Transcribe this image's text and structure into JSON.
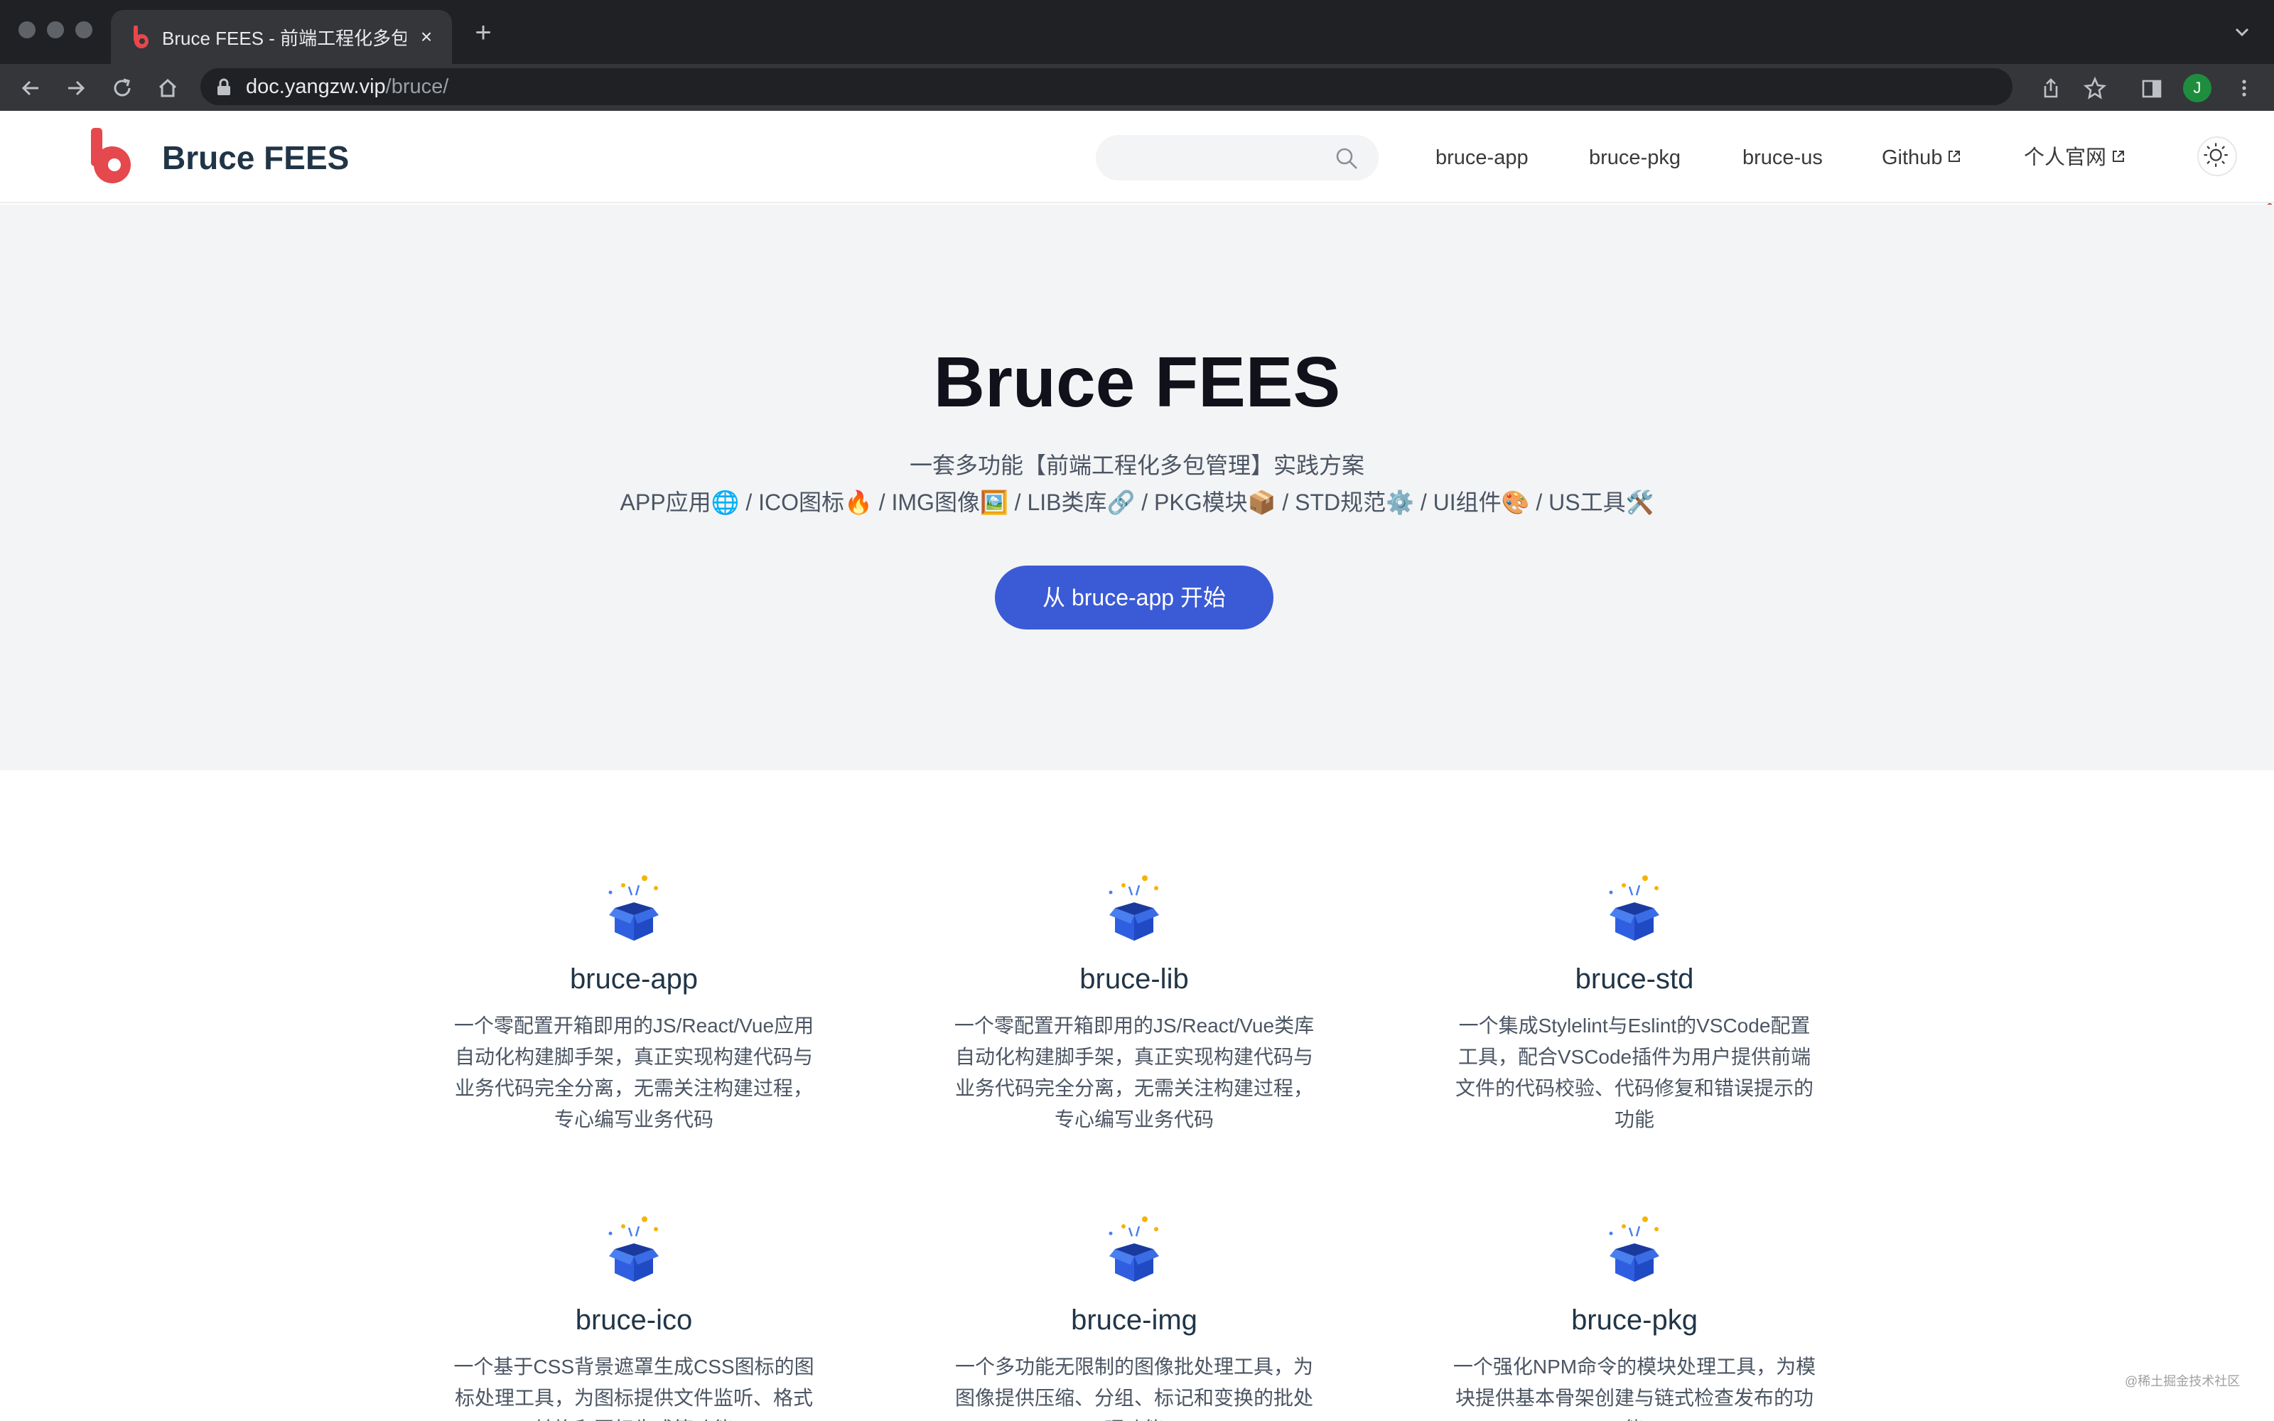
{
  "browser": {
    "tab": {
      "title": "Bruce FEES - 前端工程化多包管",
      "close": "×"
    },
    "new_tab": "+",
    "url": {
      "host": "doc.yangzw.vip",
      "path": "/bruce/"
    },
    "profile_initial": "J"
  },
  "site": {
    "brand": "Bruce FEES",
    "search": {
      "placeholder": ""
    },
    "nav": [
      {
        "label": "bruce-app"
      },
      {
        "label": "bruce-pkg"
      },
      {
        "label": "bruce-us"
      },
      {
        "label": "Github",
        "external": true
      },
      {
        "label": "个人官网",
        "external": true
      }
    ]
  },
  "hero": {
    "title": "Bruce FEES",
    "subtitle": "一套多功能【前端工程化多包管理】实践方案",
    "modules": "APP应用🌐 / ICO图标🔥 / IMG图像🖼️ / LIB类库🔗 / PKG模块📦 / STD规范⚙️ / UI组件🎨 / US工具🛠️",
    "cta": "从 bruce-app 开始"
  },
  "features": [
    {
      "title": "bruce-app",
      "desc": "一个零配置开箱即用的JS/React/Vue应用自动化构建脚手架，真正实现构建代码与业务代码完全分离，无需关注构建过程，专心编写业务代码",
      "icon": "gift-box-icon"
    },
    {
      "title": "bruce-lib",
      "desc": "一个零配置开箱即用的JS/React/Vue类库自动化构建脚手架，真正实现构建代码与业务代码完全分离，无需关注构建过程，专心编写业务代码",
      "icon": "gift-box-icon"
    },
    {
      "title": "bruce-std",
      "desc": "一个集成Stylelint与Eslint的VSCode配置工具，配合VSCode插件为用户提供前端文件的代码校验、代码修复和错误提示的功能",
      "icon": "gift-box-icon"
    },
    {
      "title": "bruce-ico",
      "desc": "一个基于CSS背景遮罩生成CSS图标的图标处理工具，为图标提供文件监听、格式转换和图标生成等功能",
      "icon": "gift-box-icon"
    },
    {
      "title": "bruce-img",
      "desc": "一个多功能无限制的图像批处理工具，为图像提供压缩、分组、标记和变换的批处理功能",
      "icon": "gift-box-icon"
    },
    {
      "title": "bruce-pkg",
      "desc": "一个强化NPM命令的模块处理工具，为模块提供基本骨架创建与链式检查发布的功能",
      "icon": "gift-box-icon"
    }
  ],
  "watermark": "@稀土掘金技术社区",
  "colors": {
    "accent": "#3b5bd6",
    "brand_red": "#e5484d",
    "hero_bg": "#f3f4f6"
  }
}
